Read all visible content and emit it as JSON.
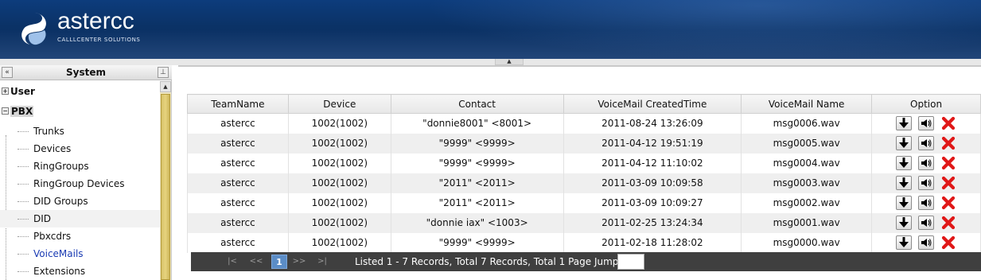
{
  "header": {
    "logo_name": "astercc",
    "logo_tagline": "CALLLCENTER SOLUTIONS"
  },
  "sidebar": {
    "title": "System",
    "collapse_glyph": "«",
    "pin_glyph": "⊥",
    "groups": [
      {
        "label": "User",
        "expanded": false,
        "toggle": "+"
      },
      {
        "label": "PBX",
        "expanded": true,
        "toggle": "−"
      }
    ],
    "items": [
      {
        "label": "Trunks"
      },
      {
        "label": "Devices"
      },
      {
        "label": "RingGroups"
      },
      {
        "label": "RingGroup Devices"
      },
      {
        "label": "DID Groups"
      },
      {
        "label": "DID"
      },
      {
        "label": "Pbxcdrs"
      },
      {
        "label": "VoiceMails"
      },
      {
        "label": "Extensions"
      }
    ]
  },
  "table": {
    "headers": [
      "TeamName",
      "Device",
      "Contact",
      "VoiceMail CreatedTime",
      "VoiceMail Name",
      "Option"
    ],
    "rows": [
      [
        "astercc",
        "1002(1002)",
        "\"donnie8001\" <8001>",
        "2011-08-24 13:26:09",
        "msg0006.wav"
      ],
      [
        "astercc",
        "1002(1002)",
        "\"9999\" <9999>",
        "2011-04-12 19:51:19",
        "msg0005.wav"
      ],
      [
        "astercc",
        "1002(1002)",
        "\"9999\" <9999>",
        "2011-04-12 11:10:02",
        "msg0004.wav"
      ],
      [
        "astercc",
        "1002(1002)",
        "\"2011\" <2011>",
        "2011-03-09 10:09:58",
        "msg0003.wav"
      ],
      [
        "astercc",
        "1002(1002)",
        "\"2011\" <2011>",
        "2011-03-09 10:09:27",
        "msg0002.wav"
      ],
      [
        "astercc",
        "1002(1002)",
        "\"donnie iax\" <1003>",
        "2011-02-25 13:24:34",
        "msg0001.wav"
      ],
      [
        "astercc",
        "1002(1002)",
        "\"9999\" <9999>",
        "2011-02-18 11:28:02",
        "msg0000.wav"
      ]
    ],
    "option_icons": [
      "download-icon",
      "play-audio-icon",
      "delete-icon"
    ]
  },
  "pager": {
    "first": "|<",
    "prev": "<<",
    "current_page": "1",
    "next": ">>",
    "last": ">|",
    "info": "Listed 1 - 7 Records, Total 7 Records, Total 1 Page Jump To",
    "jump_value": ""
  },
  "colors": {
    "header_blue": "#0b3266",
    "pager_bg": "#3f3f3f",
    "current_page": "#5b8dc7",
    "delete_red": "#e01818",
    "scroll_thumb": "#e6d37e"
  }
}
